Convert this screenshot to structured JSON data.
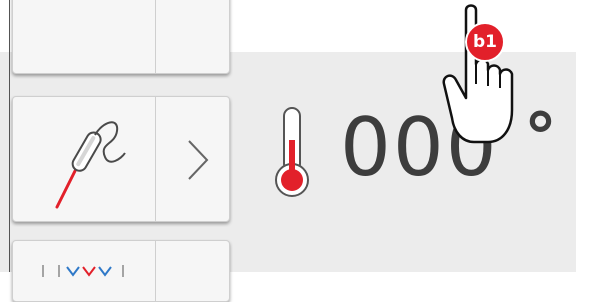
{
  "display": {
    "temperature_value": "000",
    "temperature_unit": "°"
  },
  "hint": {
    "badge_label": "b1"
  },
  "icons": {
    "probe": "core-probe-icon",
    "chevron": "chevron-right-icon",
    "thermometer": "thermometer-icon",
    "hand": "pointing-hand-icon"
  },
  "colors": {
    "accent": "#e2202a",
    "text": "#3d3d3d",
    "panel": "#ececec"
  }
}
